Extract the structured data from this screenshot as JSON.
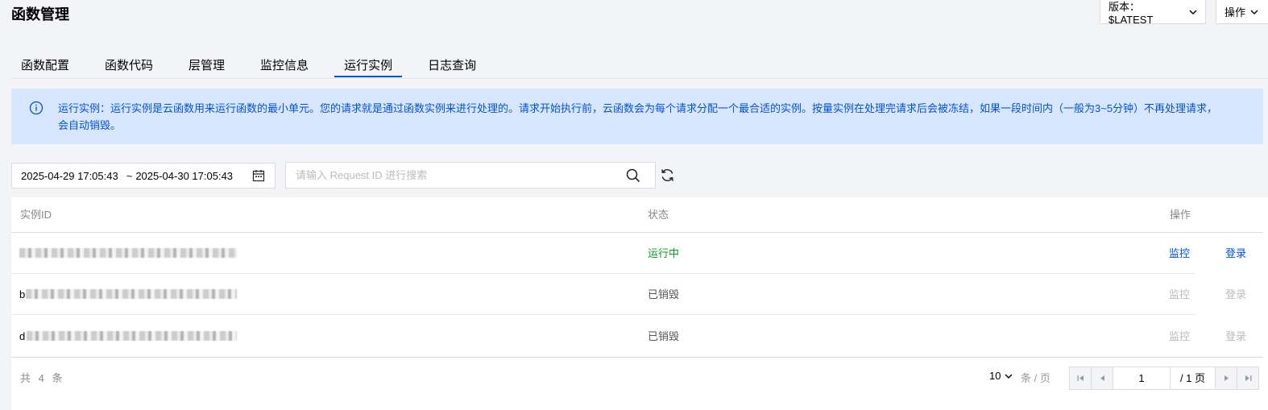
{
  "header": {
    "title": "函数管理",
    "version_label": "版本：$LATEST",
    "ops_label": "操作"
  },
  "tabs": [
    {
      "label": "函数配置",
      "active": false
    },
    {
      "label": "函数代码",
      "active": false
    },
    {
      "label": "层管理",
      "active": false
    },
    {
      "label": "监控信息",
      "active": false
    },
    {
      "label": "运行实例",
      "active": true
    },
    {
      "label": "日志查询",
      "active": false
    }
  ],
  "banner": {
    "text": "运行实例：运行实例是云函数用来运行函数的最小单元。您的请求就是通过函数实例来进行处理的。请求开始执行前，云函数会为每个请求分配一个最合适的实例。按量实例在处理完请求后会被冻结，如果一段时间内（一般为3~5分钟）不再处理请求，会自动销毁。"
  },
  "filters": {
    "date_start": "2025-04-29 17:05:43",
    "date_sep": "~",
    "date_end": "2025-04-30 17:05:43",
    "search_placeholder": "请输入 Request ID 进行搜索",
    "search_value": ""
  },
  "table": {
    "columns": {
      "instance_id": "实例ID",
      "status": "状态",
      "actions": "操作"
    },
    "rows": [
      {
        "id_prefix": "",
        "status": "运行中",
        "status_kind": "running",
        "monitor": "监控",
        "login": "登录",
        "enabled": true
      },
      {
        "id_prefix": "b",
        "status": "已销毁",
        "status_kind": "destroyed",
        "monitor": "监控",
        "login": "登录",
        "enabled": false
      },
      {
        "id_prefix": "d",
        "status": "已销毁",
        "status_kind": "destroyed",
        "monitor": "监控",
        "login": "登录",
        "enabled": false
      }
    ]
  },
  "pagination": {
    "total_text": "共 4 条",
    "page_size": "10",
    "per_page_label": "条 / 页",
    "current_page": "1",
    "total_pages_text": "/ 1 页"
  },
  "colors": {
    "accent": "#0052d9",
    "running": "#0a9c1f",
    "banner_bg": "#d9e6ff",
    "disabled": "#bbbbbb"
  }
}
